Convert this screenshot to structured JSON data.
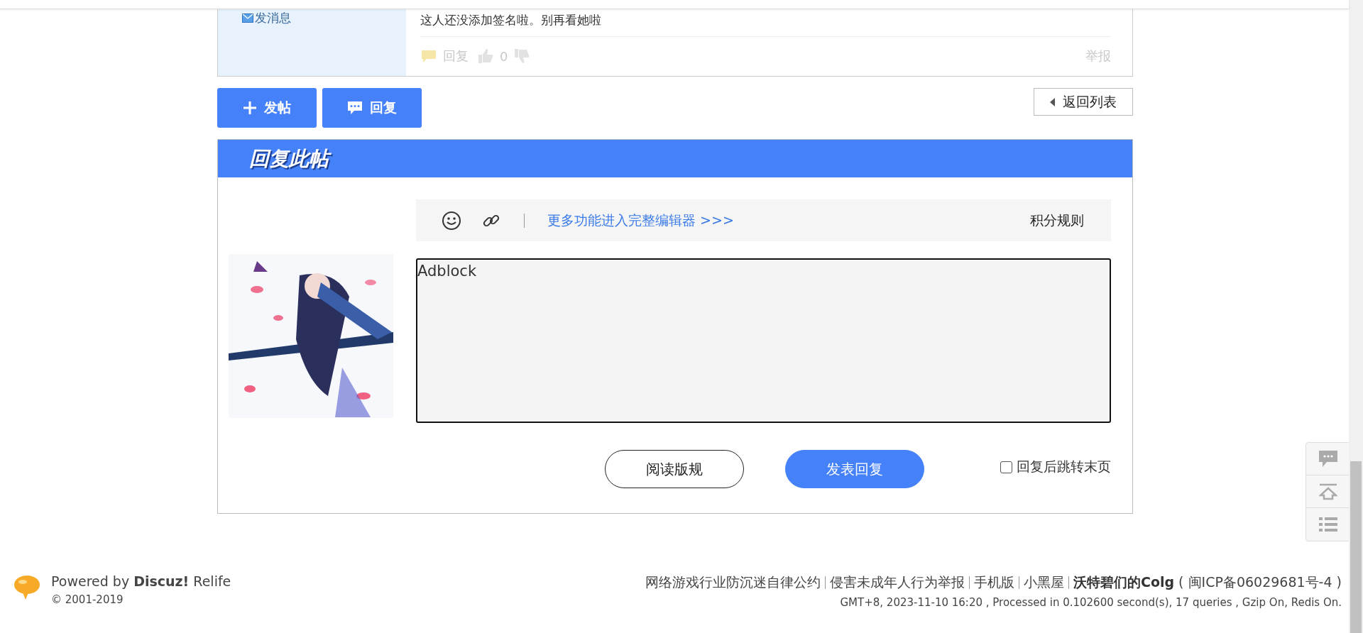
{
  "post": {
    "send_message": "发消息",
    "signature": "这人还没添加签名啦。别再看她啦",
    "reply": "回复",
    "likes": "0",
    "report": "举报"
  },
  "actions": {
    "new_post": "发帖",
    "reply": "回复",
    "back_to_list": "返回列表"
  },
  "reply_panel": {
    "title": "回复此帖",
    "full_editor_link": "更多功能进入完整编辑器 >>>",
    "points_rules": "积分规则",
    "message": "Adblock",
    "read_rules": "阅读版规",
    "submit": "发表回复",
    "jump_to_last": {
      "label": "回复后跳转末页",
      "checked": false
    }
  },
  "footer": {
    "powered_by": "Powered by **Discuz!** Relife",
    "copyright": "© 2001-2019",
    "links": [
      {
        "label": "网络游戏行业防沉迷自律公约"
      },
      {
        "label": "侵害未成年人行为举报"
      },
      {
        "label": "手机版"
      },
      {
        "label": "小黑屋"
      }
    ],
    "site": "沃特碧们的Colg",
    "icp": "( 闽ICP备06029681号-4 )",
    "stats": "GMT+8, 2023-11-10 16:20 , Processed in 0.102600 second(s), 17 queries , Gzip On, Redis On."
  }
}
